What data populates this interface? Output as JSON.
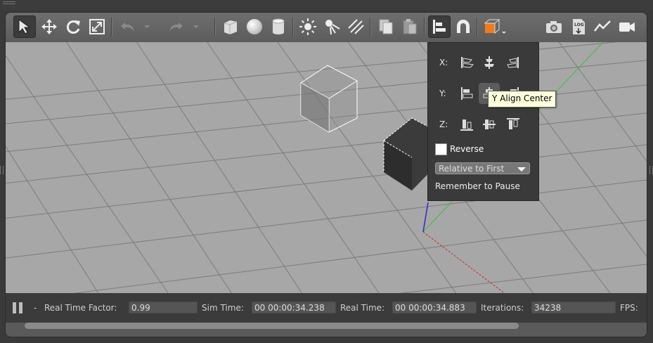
{
  "toolbar": {
    "tools": [
      {
        "name": "select-tool",
        "icon": "arrow-pointer-icon"
      },
      {
        "name": "translate-tool",
        "icon": "move-arrows-icon"
      },
      {
        "name": "rotate-tool",
        "icon": "rotate-icon"
      },
      {
        "name": "scale-tool",
        "icon": "scale-icon"
      },
      {
        "name": "undo",
        "icon": "undo-icon"
      },
      {
        "name": "undo-history",
        "icon": "chevron-down-icon"
      },
      {
        "name": "redo",
        "icon": "redo-icon"
      },
      {
        "name": "redo-history",
        "icon": "chevron-down-icon"
      },
      {
        "name": "box-shape",
        "icon": "cube-icon"
      },
      {
        "name": "sphere-shape",
        "icon": "sphere-icon"
      },
      {
        "name": "cylinder-shape",
        "icon": "cylinder-icon"
      },
      {
        "name": "point-light",
        "icon": "sun-icon"
      },
      {
        "name": "spot-light",
        "icon": "spotlight-icon"
      },
      {
        "name": "directional-light",
        "icon": "directional-light-icon"
      },
      {
        "name": "copy",
        "icon": "copy-icon"
      },
      {
        "name": "paste",
        "icon": "paste-icon"
      },
      {
        "name": "align",
        "icon": "align-icon"
      },
      {
        "name": "snap",
        "icon": "magnet-icon"
      },
      {
        "name": "view-angle",
        "icon": "orange-cube-icon"
      },
      {
        "name": "screenshot",
        "icon": "camera-icon"
      },
      {
        "name": "log",
        "icon": "log-icon"
      },
      {
        "name": "plot",
        "icon": "line-chart-icon"
      },
      {
        "name": "video-record",
        "icon": "video-camera-icon"
      }
    ],
    "log_icon_text": "LOG"
  },
  "align_panel": {
    "x_label": "X:",
    "y_label": "Y:",
    "z_label": "Z:",
    "reverse_label": "Reverse",
    "reverse_checked": false,
    "relative_select": "Relative to First",
    "remember_label": "Remember to Pause"
  },
  "tooltip": "Y Align Center",
  "status": {
    "dash": "-",
    "rtf_label": "Real Time Factor:",
    "rtf_value": "0.99",
    "sim_label": "Sim Time:",
    "sim_value": "00 00:00:34.238",
    "real_label": "Real Time:",
    "real_value": "00 00:00:34.883",
    "iter_label": "Iterations:",
    "iter_value": "34238",
    "fps_label": "FPS:"
  },
  "colors": {
    "viewport_bg": "#a7a7a7",
    "grid_line": "#7a7a7a",
    "axis_x": "#cc2a2a",
    "axis_y": "#3bbf3b",
    "axis_z": "#2a2acc",
    "accent_orange": "#f07b1e"
  }
}
